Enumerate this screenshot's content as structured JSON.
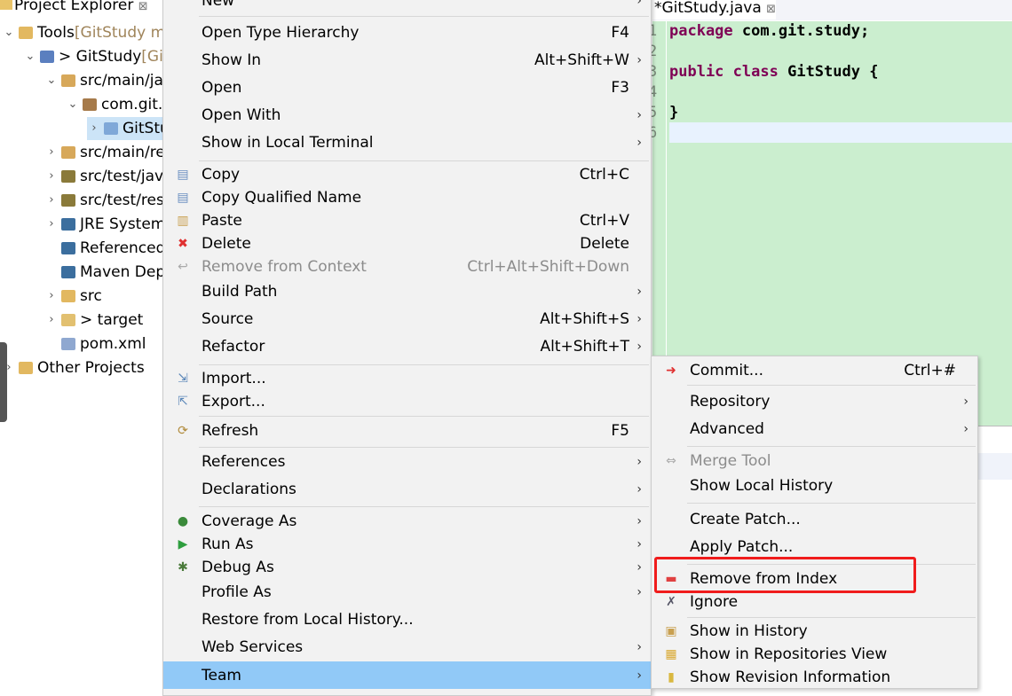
{
  "explorer": {
    "tab_title": "Project Explorer",
    "close_glyph": "⊠",
    "rows": [
      {
        "label": "Tools",
        "decoration": " [GitStudy m",
        "indent": 0,
        "chevron": "expanded",
        "icon": "project-folder-icon"
      },
      {
        "label": "> GitStudy",
        "decoration": " [Gi",
        "indent": 1,
        "chevron": "expanded",
        "icon": "maven-project-icon"
      },
      {
        "label": "src/main/java",
        "indent": 2,
        "chevron": "expanded",
        "icon": "source-folder-icon"
      },
      {
        "label": "com.git.study",
        "indent": 3,
        "chevron": "expanded",
        "icon": "package-icon"
      },
      {
        "label": "GitStudy.java",
        "indent": 4,
        "chevron": "collapsed",
        "icon": "java-file-added-icon",
        "selected": true
      },
      {
        "label": "src/main/resources",
        "indent": 2,
        "chevron": "collapsed",
        "icon": "source-folder-icon"
      },
      {
        "label": "src/test/java",
        "indent": 2,
        "chevron": "collapsed",
        "icon": "test-folder-icon"
      },
      {
        "label": "src/test/resources",
        "indent": 2,
        "chevron": "collapsed",
        "icon": "test-folder-icon"
      },
      {
        "label": "JRE System Library",
        "indent": 2,
        "chevron": "collapsed",
        "icon": "library-icon"
      },
      {
        "label": "Referenced Libraries",
        "indent": 2,
        "chevron": "none",
        "icon": "library-icon"
      },
      {
        "label": "Maven Dependencies",
        "indent": 2,
        "chevron": "none",
        "icon": "library-icon"
      },
      {
        "label": "src",
        "indent": 2,
        "chevron": "collapsed",
        "icon": "folder-icon"
      },
      {
        "label": "> target",
        "indent": 2,
        "chevron": "collapsed",
        "icon": "untracked-folder-icon"
      },
      {
        "label": "pom.xml",
        "indent": 2,
        "chevron": "none",
        "icon": "xml-file-icon"
      },
      {
        "label": "Other Projects",
        "indent": 0,
        "chevron": "collapsed",
        "icon": "working-set-icon"
      }
    ]
  },
  "editor": {
    "tab_title": "*GitStudy.java",
    "close_glyph": "⊠",
    "line_numbers": [
      "1",
      "2",
      "3",
      "4",
      "5",
      "6"
    ],
    "lines": [
      [
        {
          "t": "package",
          "kw": true
        },
        {
          "t": " com.git.study;"
        }
      ],
      [],
      [
        {
          "t": "public",
          "kw": true
        },
        {
          "t": " "
        },
        {
          "t": "class",
          "kw": true
        },
        {
          "t": " GitStudy {"
        }
      ],
      [],
      [
        {
          "t": "}"
        }
      ],
      []
    ]
  },
  "context_menu": {
    "items": [
      {
        "label": "New",
        "submenu": true
      },
      {
        "sep": true
      },
      {
        "label": "Open Type Hierarchy",
        "shortcut": "F4"
      },
      {
        "label": "Show In",
        "shortcut": "Alt+Shift+W",
        "submenu": true
      },
      {
        "label": "Open",
        "shortcut": "F3"
      },
      {
        "label": "Open With",
        "submenu": true
      },
      {
        "label": "Show in Local Terminal",
        "submenu": true
      },
      {
        "sep": true
      },
      {
        "label": "Copy",
        "shortcut": "Ctrl+C",
        "icon": "copy-icon"
      },
      {
        "label": "Copy Qualified Name",
        "icon": "copy-qualified-name-icon"
      },
      {
        "label": "Paste",
        "shortcut": "Ctrl+V",
        "icon": "paste-icon"
      },
      {
        "label": "Delete",
        "shortcut": "Delete",
        "icon": "delete-icon"
      },
      {
        "label": "Remove from Context",
        "shortcut": "Ctrl+Alt+Shift+Down",
        "icon": "remove-context-icon",
        "disabled": true
      },
      {
        "label": "Build Path",
        "submenu": true
      },
      {
        "label": "Source",
        "shortcut": "Alt+Shift+S",
        "submenu": true
      },
      {
        "label": "Refactor",
        "shortcut": "Alt+Shift+T",
        "submenu": true
      },
      {
        "sep": true
      },
      {
        "label": "Import...",
        "icon": "import-icon"
      },
      {
        "label": "Export...",
        "icon": "export-icon"
      },
      {
        "sep": true
      },
      {
        "label": "Refresh",
        "shortcut": "F5",
        "icon": "refresh-icon"
      },
      {
        "sep": true
      },
      {
        "label": "References",
        "submenu": true
      },
      {
        "label": "Declarations",
        "submenu": true
      },
      {
        "sep": true
      },
      {
        "label": "Coverage As",
        "submenu": true,
        "icon": "coverage-icon"
      },
      {
        "label": "Run As",
        "submenu": true,
        "icon": "run-icon"
      },
      {
        "label": "Debug As",
        "submenu": true,
        "icon": "debug-icon"
      },
      {
        "label": "Profile As",
        "submenu": true
      },
      {
        "label": "Restore from Local History..."
      },
      {
        "label": "Web Services",
        "submenu": true
      },
      {
        "label": "Team",
        "submenu": true,
        "highlighted": true
      }
    ]
  },
  "team_menu": {
    "items": [
      {
        "label": "Commit...",
        "shortcut": "Ctrl+#",
        "icon": "commit-icon"
      },
      {
        "sep": true
      },
      {
        "label": "Repository",
        "submenu": true
      },
      {
        "label": "Advanced",
        "submenu": true
      },
      {
        "sep": true
      },
      {
        "label": "Merge Tool",
        "icon": "merge-tool-icon",
        "disabled": true
      },
      {
        "label": "Show Local History"
      },
      {
        "sep": true
      },
      {
        "label": "Create Patch..."
      },
      {
        "label": "Apply Patch..."
      },
      {
        "sep": true
      },
      {
        "label": "Remove from Index",
        "icon": "remove-from-index-icon",
        "annotated": true
      },
      {
        "label": "Ignore",
        "icon": "ignore-icon"
      },
      {
        "sep": true
      },
      {
        "label": "Show in History",
        "icon": "history-icon"
      },
      {
        "label": "Show in Repositories View",
        "icon": "git-repository-icon"
      },
      {
        "label": "Show Revision Information",
        "icon": "revision-info-icon"
      }
    ]
  },
  "colors": {
    "highlight": "#91c9f7",
    "annotation": "#f01c1c",
    "editor_bg": "#cbeecf",
    "keyword": "#7f0055"
  }
}
